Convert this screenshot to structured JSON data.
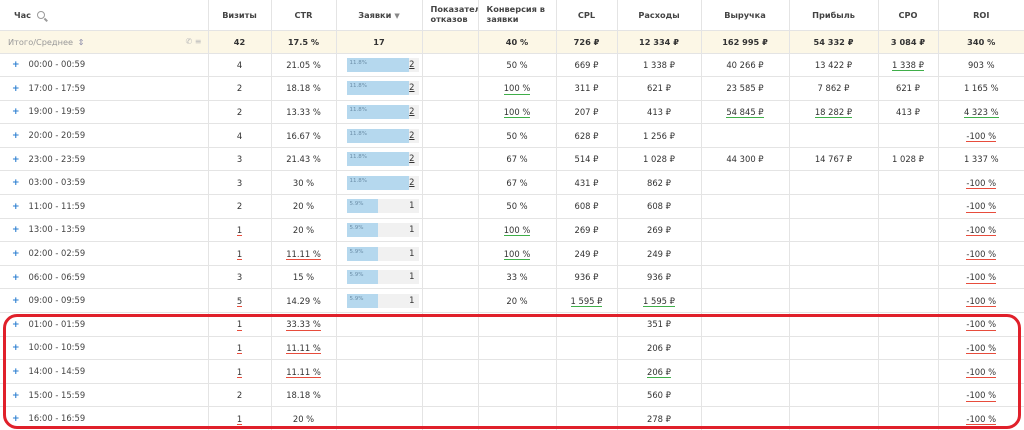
{
  "header": {
    "hour": "Час",
    "visits": "Визиты",
    "ctr": "CTR",
    "leads": "Заявки",
    "bounce": "Показатель отказов",
    "conv": "Конверсия в заявки",
    "cpl": "CPL",
    "expenses": "Расходы",
    "revenue": "Выручка",
    "profit": "Прибыль",
    "cpo": "CPO",
    "roi": "ROI"
  },
  "total": {
    "label": "Итого/Среднее",
    "visits": "42",
    "ctr": "17.5 %",
    "leads": "17",
    "bounce": "",
    "conv": "40 %",
    "cpl": "726 ₽",
    "expenses": "12 334 ₽",
    "revenue": "162 995 ₽",
    "profit": "54 332 ₽",
    "cpo": "3 084 ₽",
    "roi": "340 %"
  },
  "rows": [
    {
      "hour": "00:00 - 00:59",
      "visits": "4",
      "ctr": "21.05 %",
      "leads_pct": "11.8%",
      "leads": "2",
      "lead_share": 0.118,
      "bounce": "",
      "conv": "50 %",
      "cpl": "669 ₽",
      "expenses": "1 338 ₽",
      "revenue": "40 266 ₽",
      "profit": "13 422 ₽",
      "cpo": "1 338 ₽",
      "roi": "903 %"
    },
    {
      "hour": "17:00 - 17:59",
      "visits": "2",
      "ctr": "18.18 %",
      "leads_pct": "11.8%",
      "leads": "2",
      "lead_share": 0.118,
      "bounce": "",
      "conv": "100 %",
      "cpl": "311 ₽",
      "expenses": "621 ₽",
      "revenue": "23 585 ₽",
      "profit": "7 862 ₽",
      "cpo": "621 ₽",
      "roi": "1 165 %"
    },
    {
      "hour": "19:00 - 19:59",
      "visits": "2",
      "ctr": "13.33 %",
      "leads_pct": "11.8%",
      "leads": "2",
      "lead_share": 0.118,
      "bounce": "",
      "conv": "100 %",
      "cpl": "207 ₽",
      "expenses": "413 ₽",
      "revenue": "54 845 ₽",
      "profit": "18 282 ₽",
      "cpo": "413 ₽",
      "roi": "4 323 %"
    },
    {
      "hour": "20:00 - 20:59",
      "visits": "4",
      "ctr": "16.67 %",
      "leads_pct": "11.8%",
      "leads": "2",
      "lead_share": 0.118,
      "bounce": "",
      "conv": "50 %",
      "cpl": "628 ₽",
      "expenses": "1 256 ₽",
      "revenue": "",
      "profit": "",
      "cpo": "",
      "roi": "-100 %"
    },
    {
      "hour": "23:00 - 23:59",
      "visits": "3",
      "ctr": "21.43 %",
      "leads_pct": "11.8%",
      "leads": "2",
      "lead_share": 0.118,
      "bounce": "",
      "conv": "67 %",
      "cpl": "514 ₽",
      "expenses": "1 028 ₽",
      "revenue": "44 300 ₽",
      "profit": "14 767 ₽",
      "cpo": "1 028 ₽",
      "roi": "1 337 %"
    },
    {
      "hour": "03:00 - 03:59",
      "visits": "3",
      "ctr": "30 %",
      "leads_pct": "11.8%",
      "leads": "2",
      "lead_share": 0.118,
      "bounce": "",
      "conv": "67 %",
      "cpl": "431 ₽",
      "expenses": "862 ₽",
      "revenue": "",
      "profit": "",
      "cpo": "",
      "roi": "-100 %"
    },
    {
      "hour": "11:00 - 11:59",
      "visits": "2",
      "ctr": "20 %",
      "leads_pct": "5.9%",
      "leads": "1",
      "lead_share": 0.059,
      "bounce": "",
      "conv": "50 %",
      "cpl": "608 ₽",
      "expenses": "608 ₽",
      "revenue": "",
      "profit": "",
      "cpo": "",
      "roi": "-100 %"
    },
    {
      "hour": "13:00 - 13:59",
      "visits": "1",
      "ctr": "20 %",
      "leads_pct": "5.9%",
      "leads": "1",
      "lead_share": 0.059,
      "bounce": "",
      "conv": "100 %",
      "cpl": "269 ₽",
      "expenses": "269 ₽",
      "revenue": "",
      "profit": "",
      "cpo": "",
      "roi": "-100 %"
    },
    {
      "hour": "02:00 - 02:59",
      "visits": "1",
      "ctr": "11.11 %",
      "leads_pct": "5.9%",
      "leads": "1",
      "lead_share": 0.059,
      "bounce": "",
      "conv": "100 %",
      "cpl": "249 ₽",
      "expenses": "249 ₽",
      "revenue": "",
      "profit": "",
      "cpo": "",
      "roi": "-100 %"
    },
    {
      "hour": "06:00 - 06:59",
      "visits": "3",
      "ctr": "15 %",
      "leads_pct": "5.9%",
      "leads": "1",
      "lead_share": 0.059,
      "bounce": "",
      "conv": "33 %",
      "cpl": "936 ₽",
      "expenses": "936 ₽",
      "revenue": "",
      "profit": "",
      "cpo": "",
      "roi": "-100 %"
    },
    {
      "hour": "09:00 - 09:59",
      "visits": "5",
      "ctr": "14.29 %",
      "leads_pct": "5.9%",
      "leads": "1",
      "lead_share": 0.059,
      "bounce": "",
      "conv": "20 %",
      "cpl": "1 595 ₽",
      "expenses": "1 595 ₽",
      "revenue": "",
      "profit": "",
      "cpo": "",
      "roi": "-100 %"
    },
    {
      "hour": "01:00 - 01:59",
      "visits": "1",
      "ctr": "33.33 %",
      "leads_pct": "",
      "leads": "",
      "bounce": "",
      "conv": "",
      "cpl": "",
      "expenses": "351 ₽",
      "revenue": "",
      "profit": "",
      "cpo": "",
      "roi": "-100 %"
    },
    {
      "hour": "10:00 - 10:59",
      "visits": "1",
      "ctr": "11.11 %",
      "leads_pct": "",
      "leads": "",
      "bounce": "",
      "conv": "",
      "cpl": "",
      "expenses": "206 ₽",
      "revenue": "",
      "profit": "",
      "cpo": "",
      "roi": "-100 %"
    },
    {
      "hour": "14:00 - 14:59",
      "visits": "1",
      "ctr": "11.11 %",
      "leads_pct": "",
      "leads": "",
      "bounce": "",
      "conv": "",
      "cpl": "",
      "expenses": "206 ₽",
      "revenue": "",
      "profit": "",
      "cpo": "",
      "roi": "-100 %"
    },
    {
      "hour": "15:00 - 15:59",
      "visits": "2",
      "ctr": "18.18 %",
      "leads_pct": "",
      "leads": "",
      "bounce": "",
      "conv": "",
      "cpl": "",
      "expenses": "560 ₽",
      "revenue": "",
      "profit": "",
      "cpo": "",
      "roi": "-100 %"
    },
    {
      "hour": "16:00 - 16:59",
      "visits": "1",
      "ctr": "20 %",
      "leads_pct": "",
      "leads": "",
      "bounce": "",
      "conv": "",
      "cpl": "",
      "expenses": "278 ₽",
      "revenue": "",
      "profit": "",
      "cpo": "",
      "roi": "-100 %"
    }
  ],
  "underlines": {
    "red": [
      "0.roi_x",
      "3.roi",
      "5.roi",
      "6.roi",
      "7.roi",
      "8.roi",
      "9.roi",
      "10.roi",
      "11.roi",
      "12.roi",
      "13.roi",
      "14.roi",
      "15.roi",
      "7.visits",
      "8.visits",
      "10.visits",
      "11.visits",
      "12.visits",
      "13.visits",
      "15.visits",
      "8.ctr",
      "11.ctr",
      "12.ctr",
      "13.ctr"
    ],
    "green": [
      "0.cpo",
      "1.conv",
      "2.conv",
      "2.revenue",
      "2.profit",
      "2.roi",
      "7.conv",
      "8.conv",
      "10.cpl",
      "10.expenses",
      "13.expenses"
    ]
  },
  "icons": {
    "search": "search-icon",
    "sort": "sort-desc-icon",
    "total_sort": "sort-toggle-icon",
    "phone": "phone-icon",
    "menu": "list-icon",
    "expand": "plus-icon"
  },
  "colors": {
    "bar_fill": "#b5d8ee",
    "total_bg": "#fcf7e6",
    "highlight": "#e0202a",
    "expand": "#2a7ed0",
    "uline_red": "#e74c3c",
    "uline_green": "#3fae49"
  },
  "symbols": {
    "sort_desc": "▼",
    "total_sort": "⇕",
    "expand": "+",
    "phone": "✆",
    "menu": "≡"
  }
}
